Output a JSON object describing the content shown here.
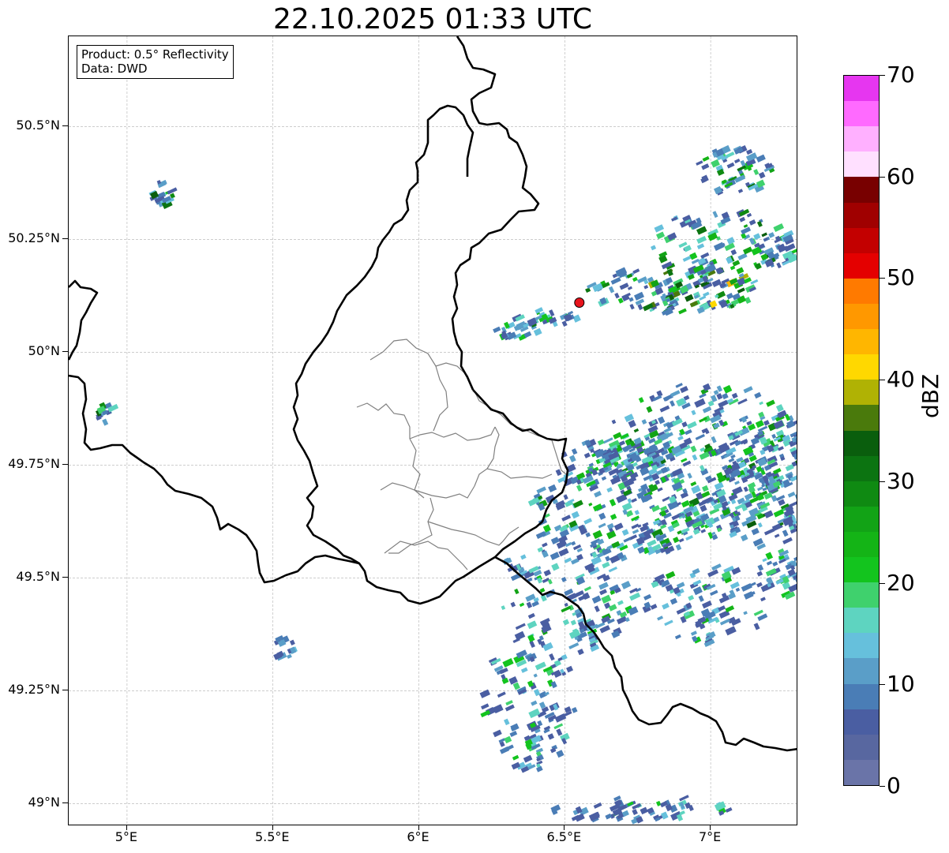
{
  "title": "22.10.2025 01:33 UTC",
  "info": {
    "product": "Product: 0.5° Reflectivity",
    "data": "Data: DWD"
  },
  "map": {
    "extent": {
      "lon": [
        4.8,
        7.3
      ],
      "lat": [
        48.95,
        50.7
      ]
    },
    "lat_ticks": [
      {
        "value": 50.5,
        "label": "50.5°N"
      },
      {
        "value": 50.25,
        "label": "50.25°N"
      },
      {
        "value": 50.0,
        "label": "50°N"
      },
      {
        "value": 49.75,
        "label": "49.75°N"
      },
      {
        "value": 49.5,
        "label": "49.5°N"
      },
      {
        "value": 49.25,
        "label": "49.25°N"
      },
      {
        "value": 49.0,
        "label": "49°N"
      }
    ],
    "lon_ticks": [
      {
        "value": 5.0,
        "label": "5°E"
      },
      {
        "value": 5.5,
        "label": "5.5°E"
      },
      {
        "value": 6.0,
        "label": "6°E"
      },
      {
        "value": 6.5,
        "label": "6.5°E"
      },
      {
        "value": 7.0,
        "label": "7°E"
      }
    ],
    "radar_site": {
      "lon": 6.55,
      "lat": 50.11,
      "color": "#e8141c"
    }
  },
  "colorbar": {
    "label": "dBZ",
    "range": [
      0,
      70
    ],
    "tick_values": [
      0,
      10,
      20,
      30,
      40,
      50,
      60,
      70
    ],
    "tick_labels": [
      "0",
      "10",
      "20",
      "30",
      "40",
      "50",
      "60",
      "70"
    ],
    "colors": [
      "#6a74a8",
      "#5867a0",
      "#4a5ea2",
      "#4a7db6",
      "#5a9ec8",
      "#66c0dc",
      "#5ed4c0",
      "#3fd16d",
      "#13c41e",
      "#14b416",
      "#12a316",
      "#0f8a12",
      "#0c7411",
      "#0a5e0d",
      "#4a7a0c",
      "#b0b204",
      "#ffd800",
      "#ffb600",
      "#ff9800",
      "#ff7a00",
      "#e40000",
      "#c30000",
      "#a00000",
      "#780000",
      "#ffe0ff",
      "#ffb0ff",
      "#ff6aff",
      "#e636f0"
    ]
  }
}
